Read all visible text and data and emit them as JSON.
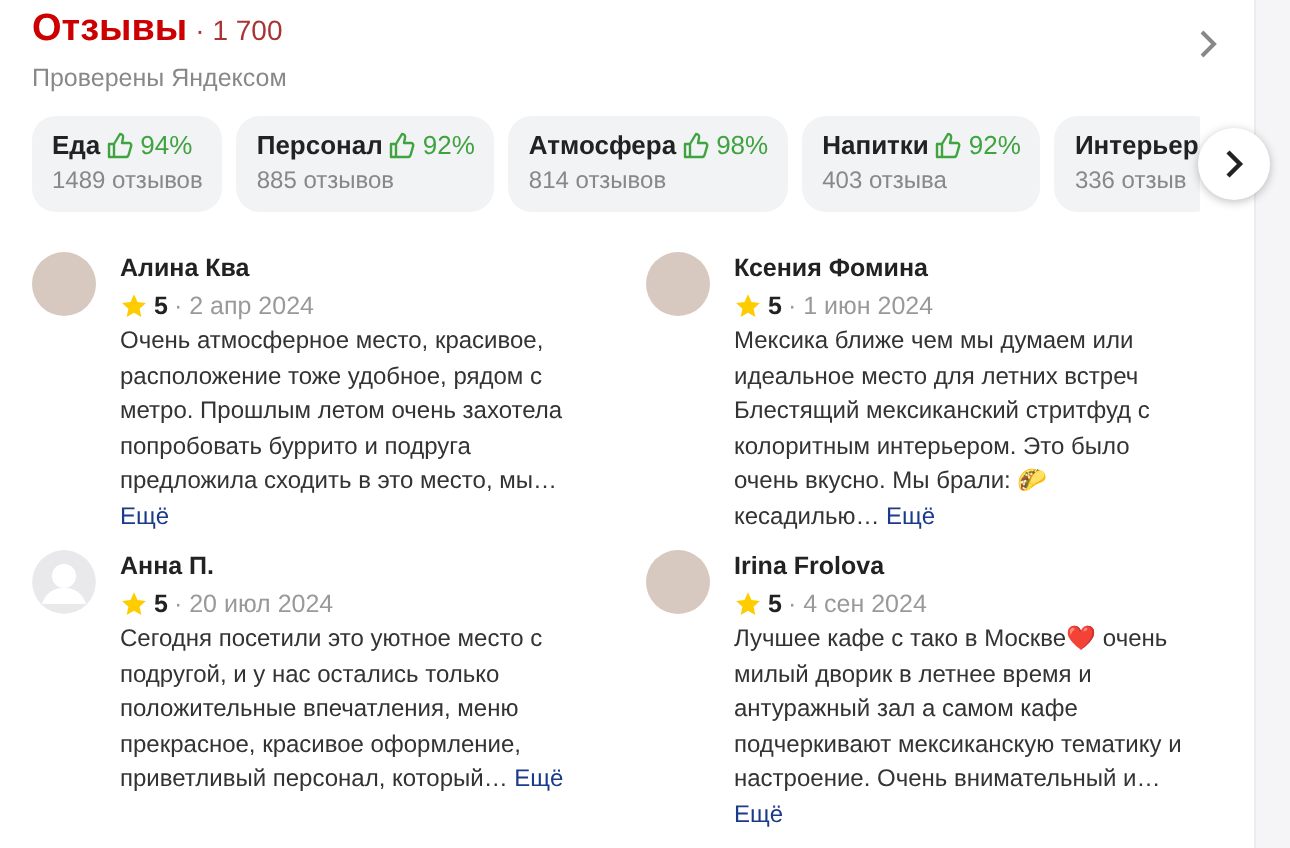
{
  "header": {
    "title": "Отзывы",
    "count": "· 1 700",
    "subtitle": "Проверены Яндексом"
  },
  "categories": [
    {
      "name": "Еда",
      "percent": "94%",
      "reviews": "1489 отзывов"
    },
    {
      "name": "Персонал",
      "percent": "92%",
      "reviews": "885 отзывов"
    },
    {
      "name": "Атмосфера",
      "percent": "98%",
      "reviews": "814 отзывов"
    },
    {
      "name": "Напитки",
      "percent": "92%",
      "reviews": "403 отзыва"
    },
    {
      "name": "Интерьер",
      "reviews": "336 отзыв"
    }
  ],
  "reviews": [
    {
      "author": "Алина Ква",
      "kind": "photo",
      "rating": "5",
      "date": "· 2 апр 2024",
      "text": "Очень атмосферное место, красивое, расположение тоже удобное, рядом с метро. Прошлым летом очень захотела попробовать буррито и подруга предложила сходить в это место, мы…",
      "more": "Ещё"
    },
    {
      "author": "Ксения Фомина",
      "kind": "photo",
      "rating": "5",
      "date": "· 1 июн 2024",
      "text": "Мексика ближе чем мы думаем или идеальное место для летних встреч Блестящий мексиканский стритфуд с колоритным интерьером. Это было очень вкусно. Мы брали: 🌮 кесадилью…",
      "more": "Ещё"
    },
    {
      "author": "Анна П.",
      "kind": "default",
      "rating": "5",
      "date": "· 20 июл 2024",
      "text": "Сегодня посетили это уютное место с подругой, и у нас остались только положительные впечатления, меню прекрасное, красивое оформление, приветливый персонал, который…",
      "more": "Ещё"
    },
    {
      "author": "Irina Frolova",
      "kind": "photo",
      "rating": "5",
      "date": "· 4 сен 2024",
      "text": "Лучшее кафе с тако в Москве❤️ очень милый дворик в летнее время и антуражный зал а самом кафе подчеркивают мексиканскую тематику и настроение. Очень внимательный и…",
      "more": "Ещё"
    }
  ]
}
